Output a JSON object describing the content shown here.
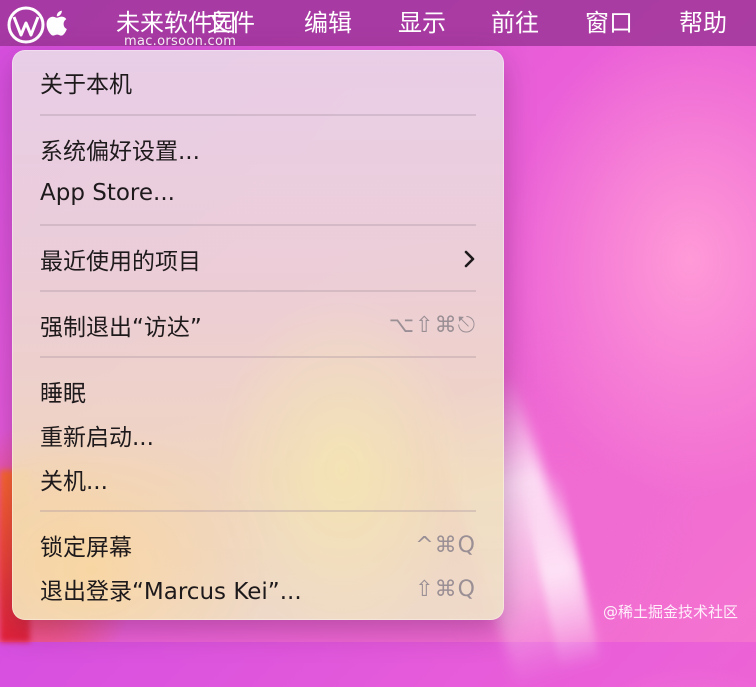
{
  "menubar": {
    "app_name": "未来软件园",
    "items": [
      "文件",
      "编辑",
      "显示",
      "前往",
      "窗口",
      "帮助"
    ]
  },
  "watermark": {
    "site": "mac.orsoon.com",
    "footer": "@稀土掘金技术社区"
  },
  "apple_menu": {
    "about": "关于本机",
    "system_prefs": "系统偏好设置...",
    "app_store": "App Store...",
    "recent_items": "最近使用的项目",
    "force_quit": "强制退出“访达”",
    "force_quit_shortcut": "⌥⇧⌘⎋",
    "sleep": "睡眠",
    "restart": "重新启动...",
    "shutdown": "关机...",
    "lock_screen": "锁定屏幕",
    "lock_screen_shortcut": "^⌘Q",
    "log_out": "退出登录“Marcus Kei”...",
    "log_out_shortcut": "⇧⌘Q"
  },
  "colors": {
    "menubar": "#9b3496",
    "wallpaper_magenta": "#e35cd8",
    "menu_text": "#1e1a1c",
    "shortcut_text": "#9a8f95"
  },
  "icons": {
    "apple": "apple-logo-icon",
    "submenu": "chevron-right-icon"
  }
}
